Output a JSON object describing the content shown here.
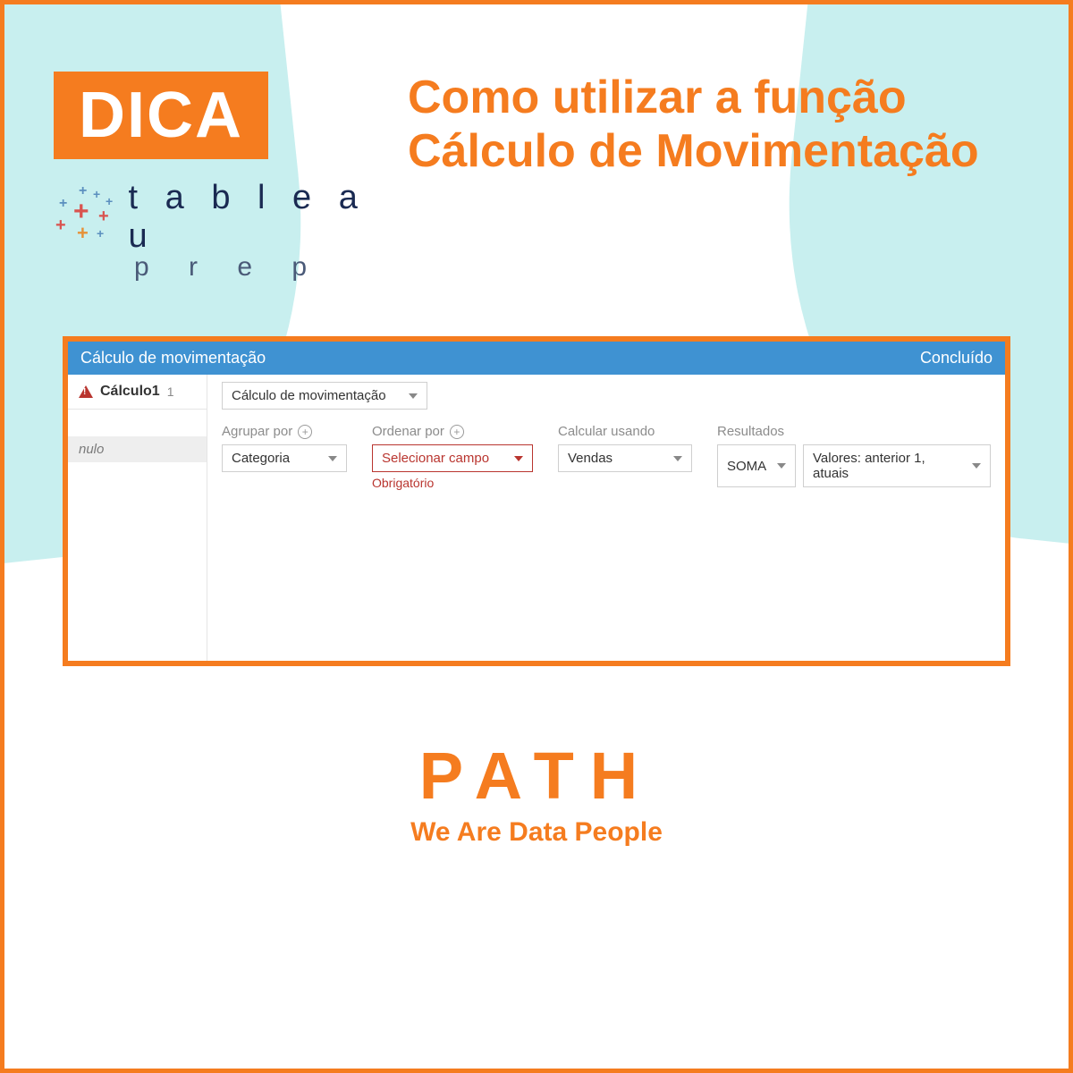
{
  "badge": "DICA",
  "product": {
    "name": "t a b l e a u",
    "sub": "p r e p"
  },
  "headline": "Como utilizar a função Cálculo de Movimentação",
  "panel": {
    "title": "Cálculo de movimentação",
    "done": "Concluído",
    "calc": {
      "name": "Cálculo1",
      "count": "1"
    },
    "nulo": "nulo",
    "type_select": "Cálculo de movimentação",
    "groupby": {
      "label": "Agrupar por",
      "value": "Categoria"
    },
    "orderby": {
      "label": "Ordenar por",
      "value": "Selecionar campo",
      "required": "Obrigatório"
    },
    "calcusing": {
      "label": "Calcular usando",
      "value": "Vendas"
    },
    "results": {
      "label": "Resultados",
      "agg": "SOMA",
      "range": "Valores: anterior 1, atuais"
    }
  },
  "footer": {
    "brand": "PATH",
    "tagline": "We Are Data People"
  }
}
